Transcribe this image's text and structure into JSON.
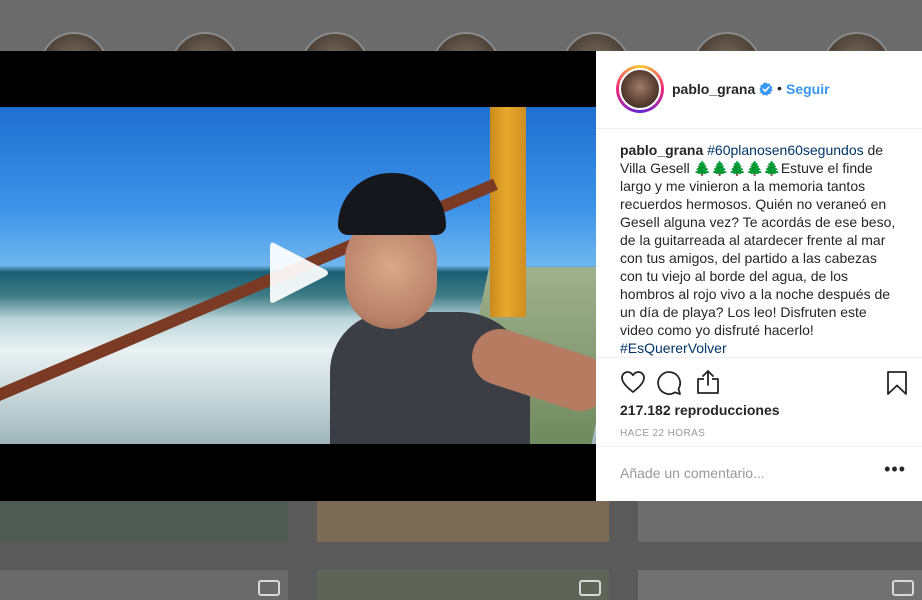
{
  "post": {
    "username": "pablo_grana",
    "follow_label": "Seguir",
    "dot": "•",
    "caption": {
      "user": "pablo_grana",
      "hashtag_1": "#60planosen60segundos",
      "text_1": " de Villa Gesell ",
      "trees": "🌲🌲🌲🌲🌲",
      "text_2": "Estuve el finde largo y me vinieron a la memoria tantos recuerdos hermosos. Quién no veraneó en Gesell alguna vez? Te acordás de ese beso, de la guitarreada al atardecer frente al mar con tus amigos, del partido a las cabezas con tu viejo al borde del agua, de los hombros al rojo vivo a la noche después de un día de playa? Los leo! Disfruten este video como yo disfruté hacerlo! ",
      "hashtag_2": "#EsQuererVolver"
    },
    "views": "217.182 reproducciones",
    "time_ago": "HACE 22 HORAS",
    "comment_placeholder": "Añade un comentario...",
    "more_label": "•••"
  },
  "icons": {
    "play": "play-icon",
    "verified": "verified-badge-icon",
    "like": "heart-icon",
    "comment": "comment-bubble-icon",
    "share": "share-icon",
    "save": "bookmark-icon"
  },
  "colors": {
    "link": "#3897f0",
    "hashtag": "#003569",
    "text": "#262626",
    "muted": "#999999"
  }
}
